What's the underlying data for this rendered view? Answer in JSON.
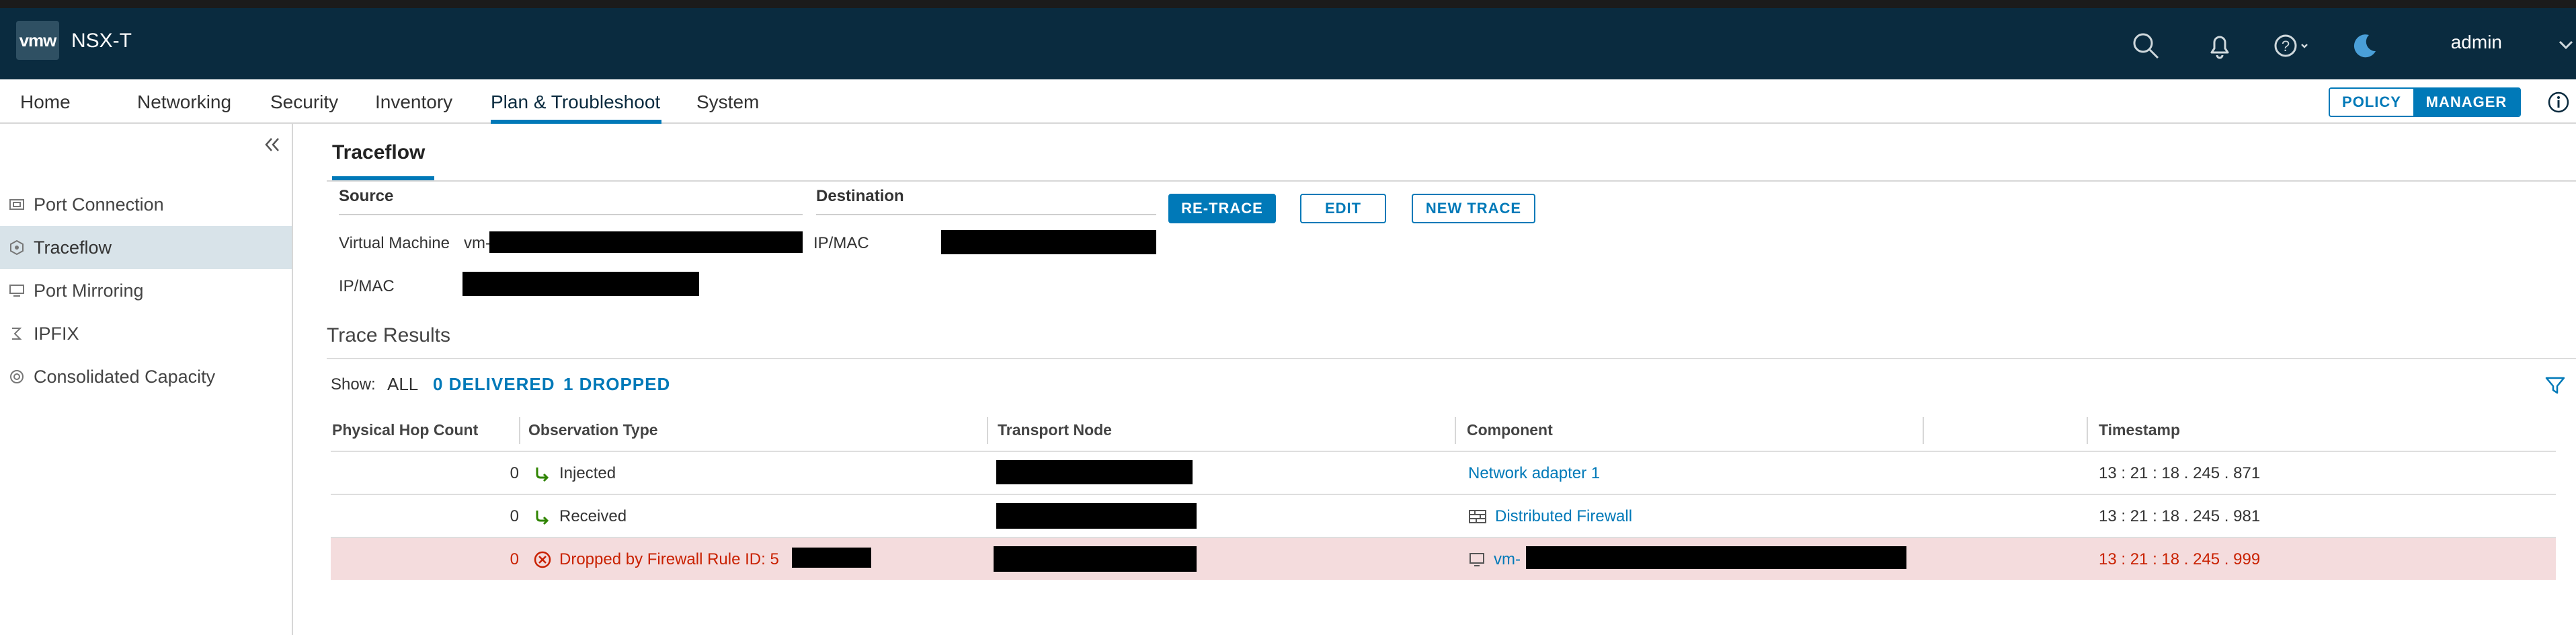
{
  "header": {
    "logo": "vmw",
    "app_title": "NSX-T",
    "user": "admin"
  },
  "nav": {
    "items": [
      "Home",
      "Networking",
      "Security",
      "Inventory",
      "Plan & Troubleshoot",
      "System"
    ],
    "active": "Plan & Troubleshoot",
    "mode_toggle": {
      "policy": "POLICY",
      "manager": "MANAGER",
      "selected": "MANAGER"
    }
  },
  "sidebar": {
    "items": [
      {
        "label": "Port Connection",
        "icon": "port-connection-icon"
      },
      {
        "label": "Traceflow",
        "icon": "traceflow-icon",
        "active": true
      },
      {
        "label": "Port Mirroring",
        "icon": "port-mirroring-icon"
      },
      {
        "label": "IPFIX",
        "icon": "ipfix-icon"
      },
      {
        "label": "Consolidated Capacity",
        "icon": "capacity-icon"
      }
    ]
  },
  "page": {
    "title": "Traceflow",
    "source": {
      "heading": "Source",
      "type_label": "Virtual Machine",
      "vm_prefix": "vm-",
      "ipmac_label": "IP/MAC"
    },
    "destination": {
      "heading": "Destination",
      "ipmac_label": "IP/MAC"
    },
    "buttons": {
      "retrace": "RE-TRACE",
      "edit": "EDIT",
      "new_trace": "NEW TRACE"
    },
    "results": {
      "title": "Trace Results",
      "show_label": "Show:",
      "filters": {
        "all": "ALL",
        "delivered": "0 DELIVERED",
        "dropped": "1 DROPPED"
      },
      "columns": [
        "Physical Hop Count",
        "Observation Type",
        "Transport Node",
        "Component",
        "Timestamp"
      ],
      "rows": [
        {
          "hop": "0",
          "observation": "Injected",
          "obs_icon": "arrow-injected-icon",
          "component": "Network adapter 1",
          "component_icon": "",
          "timestamp": "13 : 21 : 18 . 245 . 871",
          "status": "normal"
        },
        {
          "hop": "0",
          "observation": "Received",
          "obs_icon": "arrow-received-icon",
          "component": "Distributed Firewall",
          "component_icon": "firewall-icon",
          "timestamp": "13 : 21 : 18 . 245 . 981",
          "status": "normal"
        },
        {
          "hop": "0",
          "observation": "Dropped by Firewall Rule ID: 5",
          "obs_icon": "error-circle-icon",
          "component": "vm-",
          "component_icon": "vm-icon",
          "timestamp": "13 : 21 : 18 . 245 . 999",
          "status": "dropped"
        }
      ]
    }
  },
  "colors": {
    "header_bg": "#0a2b3f",
    "accent": "#0079b8",
    "error_row": "#f4dcdd",
    "error_text": "#c92100",
    "success": "#2f8400"
  }
}
